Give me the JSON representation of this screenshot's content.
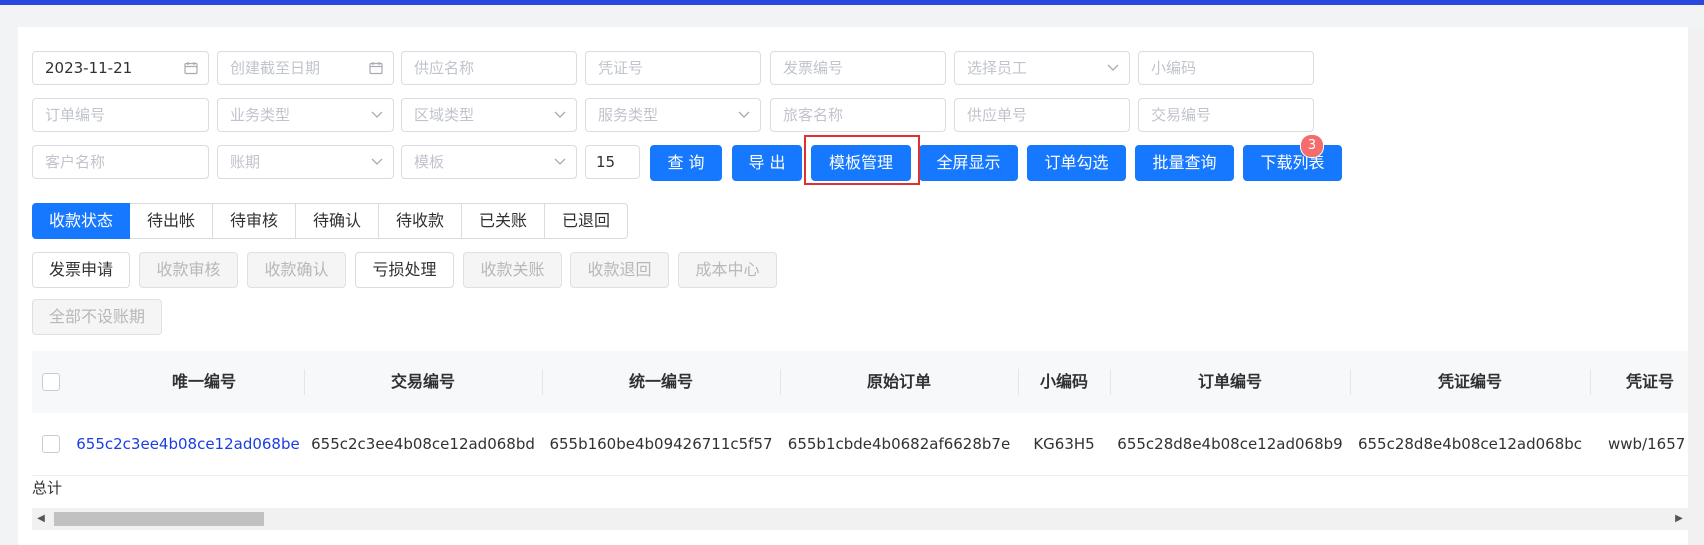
{
  "filters": {
    "row1": {
      "create_date_start": "2023-11-21",
      "create_date_end_placeholder": "创建截至日期",
      "supplier_name_placeholder": "供应名称",
      "voucher_no_placeholder": "凭证号",
      "invoice_no_placeholder": "发票编号",
      "employee_placeholder": "选择员工",
      "short_code_placeholder": "小编码"
    },
    "row2": {
      "order_no_placeholder": "订单编号",
      "business_type_placeholder": "业务类型",
      "region_type_placeholder": "区域类型",
      "service_type_placeholder": "服务类型",
      "traveler_name_placeholder": "旅客名称",
      "supplier_order_placeholder": "供应单号",
      "transaction_no_placeholder": "交易编号"
    },
    "row3": {
      "customer_name_placeholder": "客户名称",
      "billing_period_placeholder": "账期",
      "template_placeholder": "模板",
      "page_size": "15"
    }
  },
  "toolbar": {
    "query": "查 询",
    "export": "导 出",
    "template_manage": "模板管理",
    "fullscreen": "全屏显示",
    "order_check": "订单勾选",
    "batch_query": "批量查询",
    "download_list": "下载列表",
    "download_badge": "3"
  },
  "status_tabs": [
    {
      "label": "收款状态",
      "active": true
    },
    {
      "label": "待出帐"
    },
    {
      "label": "待审核"
    },
    {
      "label": "待确认"
    },
    {
      "label": "待收款"
    },
    {
      "label": "已关账"
    },
    {
      "label": "已退回"
    }
  ],
  "actions": {
    "invoice_apply": "发票申请",
    "payment_review": "收款审核",
    "payment_confirm": "收款确认",
    "loss_handle": "亏损处理",
    "payment_close": "收款关账",
    "payment_return": "收款退回",
    "cost_center": "成本中心",
    "no_billing_all": "全部不设账期"
  },
  "table": {
    "columns": [
      "唯一编号",
      "交易编号",
      "统一编号",
      "原始订单",
      "小编码",
      "订单编号",
      "凭证编号",
      "凭证号"
    ],
    "rows": [
      [
        "655c2c3ee4b08ce12ad068be",
        "655c2c3ee4b08ce12ad068bd",
        "655b160be4b09426711c5f57",
        "655b1cbde4b0682af6628b7e",
        "KG63H5",
        "655c28d8e4b08ce12ad068b9",
        "655c28d8e4b08ce12ad068bc",
        "wwb/1657"
      ]
    ],
    "total_label": "总计"
  },
  "colors": {
    "primary": "#1677ff",
    "top_bar": "#2948e0",
    "link": "#1a3ee0",
    "badge": "#f56c6c",
    "highlight_box": "#e03131"
  }
}
